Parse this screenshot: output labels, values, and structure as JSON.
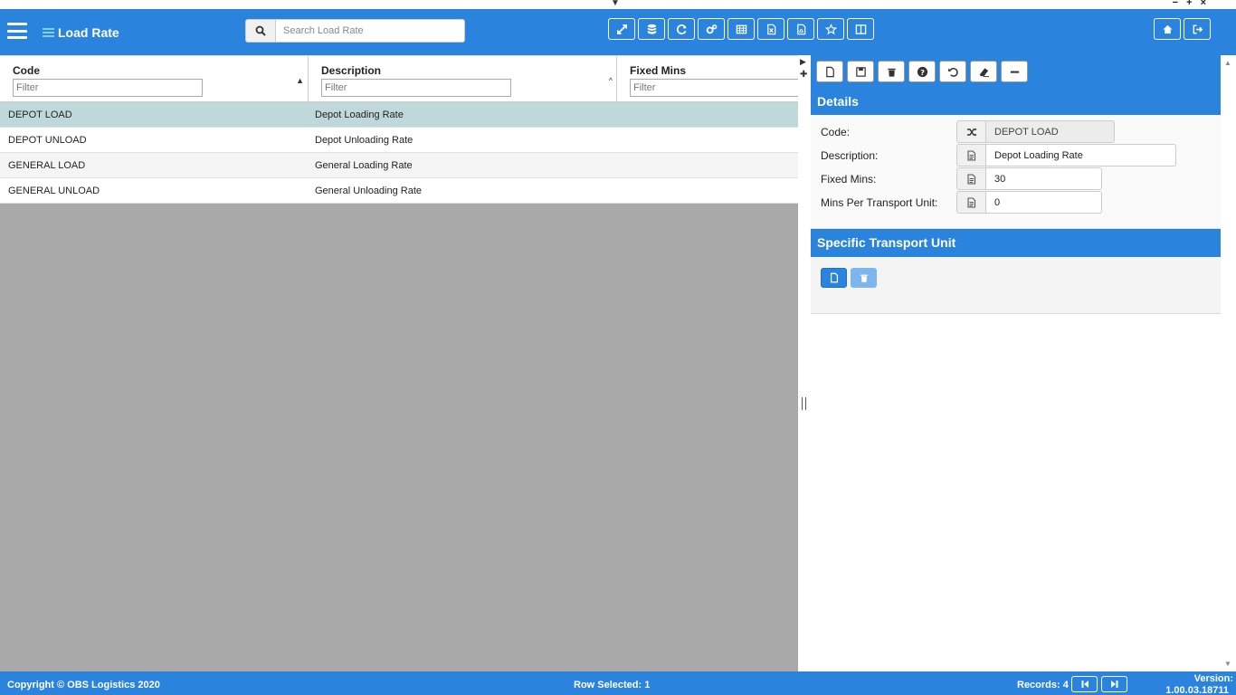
{
  "window": {
    "dropdown_glyph": "▼",
    "controls": "− + ×"
  },
  "header": {
    "title": "Load Rate",
    "search_placeholder": "Search Load Rate",
    "toolbar_icons": [
      "expand-icon",
      "database-icon",
      "refresh-icon",
      "cogs-icon",
      "table-icon",
      "export-excel-icon",
      "export-pdf-icon",
      "star-icon",
      "columns-icon"
    ],
    "right_icons": [
      "home-icon",
      "logout-icon"
    ]
  },
  "grid": {
    "columns": [
      {
        "label": "Code",
        "filter_placeholder": "Filter"
      },
      {
        "label": "Description",
        "filter_placeholder": "Filter"
      },
      {
        "label": "Fixed Mins",
        "filter_placeholder": "Filter"
      }
    ],
    "rows": [
      {
        "code": "DEPOT LOAD",
        "description": "Depot Loading Rate",
        "selected": true
      },
      {
        "code": "DEPOT UNLOAD",
        "description": "Depot Unloading Rate",
        "selected": false
      },
      {
        "code": "GENERAL LOAD",
        "description": "General Loading Rate",
        "selected": false
      },
      {
        "code": "GENERAL UNLOAD",
        "description": "General Unloading Rate",
        "selected": false
      }
    ]
  },
  "details": {
    "toolbar_icons": [
      "new-icon",
      "save-icon",
      "delete-icon",
      "help-icon",
      "undo-icon",
      "eraser-icon",
      "minimize-icon"
    ],
    "section_title": "Details",
    "fields": [
      {
        "label": "Code:",
        "value": "DEPOT LOAD",
        "readonly": true
      },
      {
        "label": "Description:",
        "value": "Depot Loading Rate",
        "readonly": false
      },
      {
        "label": "Fixed Mins:",
        "value": "30",
        "readonly": false
      },
      {
        "label": "Mins Per Transport Unit:",
        "value": "0",
        "readonly": false
      }
    ],
    "subsection_title": "Specific Transport Unit"
  },
  "footer": {
    "copyright": "Copyright © OBS Logistics 2020",
    "row_selected": "Row Selected: 1",
    "records": "Records: 4",
    "version_label": "Version:",
    "version_number": "1.00.03.18711"
  },
  "colors": {
    "primary": "#2a84de",
    "selected_row": "#bfd9da",
    "empty_grid": "#a9a9a9"
  }
}
